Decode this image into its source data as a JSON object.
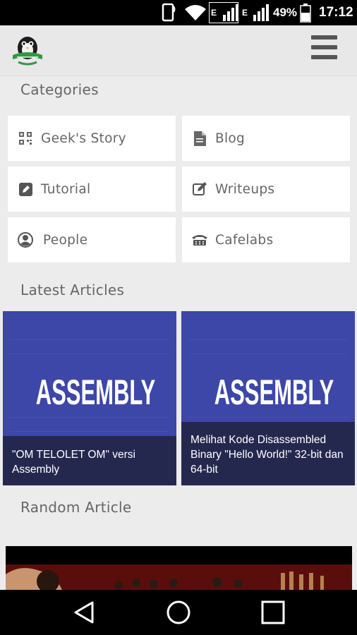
{
  "status_bar": {
    "signal1_label": "E",
    "signal2_label": "E",
    "battery": "49%",
    "time": "17:12"
  },
  "app_bar": {
    "logo_icon": "cafelabs-penguin-logo",
    "menu_icon": "hamburger-menu-icon"
  },
  "categories": {
    "title": "Categories",
    "items": [
      {
        "label": "Geek's Story",
        "icon": "qr-code-icon"
      },
      {
        "label": "Blog",
        "icon": "document-icon"
      },
      {
        "label": "Tutorial",
        "icon": "edit-box-icon"
      },
      {
        "label": "Writeups",
        "icon": "pencil-square-icon"
      },
      {
        "label": "People",
        "icon": "user-circle-icon"
      },
      {
        "label": "Cafelabs",
        "icon": "telephone-icon"
      }
    ]
  },
  "latest": {
    "title": "Latest Articles",
    "articles": [
      {
        "image_text": "ASSEMBLY",
        "caption": "\"OM TELOLET OM\" versi Assembly"
      },
      {
        "image_text": "ASSEMBLY",
        "caption": "Melihat Kode Disassembled Binary \"Hello World!\" 32-bit dan 64-bit"
      }
    ]
  },
  "random": {
    "title": "Random Article"
  },
  "colors": {
    "article_bg": "#3d47a8",
    "caption_bg": "#232646",
    "page_bg": "#ececec"
  }
}
